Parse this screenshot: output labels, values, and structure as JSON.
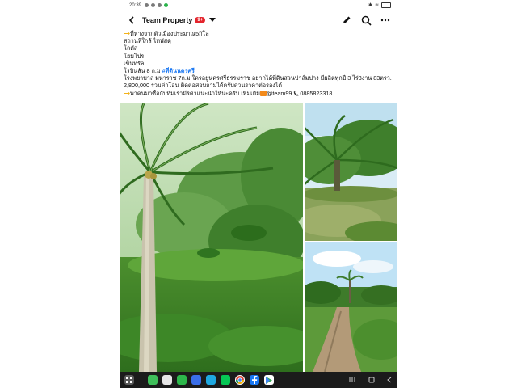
{
  "status": {
    "time": "20:39",
    "colors": {
      "notif": "#7a7a7a",
      "line_app": "#29b34a"
    }
  },
  "header": {
    "title": "Team Property",
    "badge": "9+",
    "icons": [
      "back-arrow-icon",
      "caret-down-icon",
      "edit-icon",
      "search-icon",
      "more-icon"
    ]
  },
  "post": {
    "lines": [
      "ที่ห่างจากตัวเมืองประมาณ5กิโล",
      "สถานที่ใกล้  ไทพัสดุ",
      "โลตัส",
      "โฮมโปร",
      "เซ็นทรัล",
      "โรบินสัน  8  ก.ม"
    ],
    "hashtag": "#ที่ดินนครศรี",
    "line7": "โรงพยาบาล มหาราช 7ก.ม.ใครอยู่นครศรีธรรมราช อยากได้ที่ดินสวนปาล์มปาง มีผลิตทุกปี 3 ไร่3งาน 83ตรว.",
    "line8": "2,800,000 รวมค่าโอน ติดต่อสอบถามได้ครับด่วนราคาต่อรองได้",
    "line9_a": "พาคนมาซื้อกับทีมเรามีรค่าแนะนำให้นะครับ เพิ่มเติม",
    "line9_b": "@team99",
    "line9_c": "0885823318"
  },
  "images": [
    {
      "name": "coconut-palm-plantation-photo"
    },
    {
      "name": "oil-palm-field-photo"
    },
    {
      "name": "dirt-road-land-photo"
    }
  ],
  "accent": {
    "link": "#1876f2",
    "badge": "#e4252d"
  }
}
